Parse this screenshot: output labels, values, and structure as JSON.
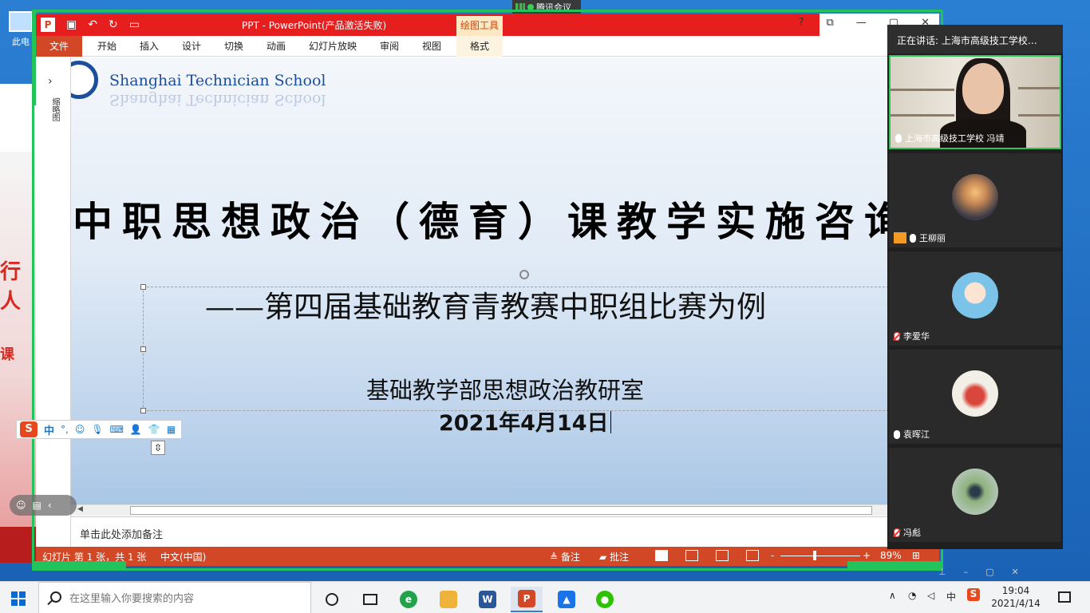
{
  "desktop": {
    "icon_label": "此电",
    "bg_text_1": "行人",
    "bg_text_2": "课"
  },
  "meeting": {
    "app_name": "腾讯会议",
    "speaking_label": "正在讲话: 上海市高级技工学校…",
    "participants": [
      {
        "name": "上海市高级技工学校 冯靖",
        "mic": "on",
        "video": true
      },
      {
        "name": "王柳丽",
        "mic": "on",
        "host": true
      },
      {
        "name": "李爱华",
        "mic": "muted"
      },
      {
        "name": "袁晖江",
        "mic": "on"
      },
      {
        "name": "冯彪",
        "mic": "muted"
      }
    ]
  },
  "ppt": {
    "title": "PPT  -  PowerPoint(产品激活失败)",
    "drawing_tools": "绘图工具",
    "help": "?",
    "tabs": {
      "file": "文件",
      "home": "开始",
      "insert": "插入",
      "design": "设计",
      "transitions": "切换",
      "animations": "动画",
      "slideshow": "幻灯片放映",
      "review": "审阅",
      "view": "视图",
      "format": "格式"
    },
    "thumbnail_label": "缩略图",
    "slide": {
      "school_name": "Shanghai Technician School",
      "title": "中职思想政治（德育）课教学实施咨询",
      "subtitle": "——第四届基础教育青教赛中职组比赛为例",
      "department": "基础教学部思想政治教研室",
      "date": "2021年4月14日"
    },
    "notes_placeholder": "单击此处添加备注",
    "status": {
      "slide_info": "幻灯片 第 1 张，共 1 张",
      "language": "中文(中国)",
      "notes": "备注",
      "comments": "批注",
      "zoom": "89%",
      "zoom_fraction": 0.41
    }
  },
  "ime": {
    "logo": "S",
    "mode": "中",
    "punct": "°,",
    "smile": "☺",
    "mic": "🎙",
    "keyboard": "⌨",
    "user": "👤",
    "shirt": "👕",
    "grid": "▦"
  },
  "taskbar": {
    "search_placeholder": "在这里输入你要搜索的内容",
    "ime_indicator": "中",
    "time": "19:04",
    "date": "2021/4/14"
  },
  "colors": {
    "ppt_red": "#d24726",
    "title_red": "#e61e1e",
    "meeting_green": "#21c35a",
    "logo_blue": "#1d4e9b"
  }
}
